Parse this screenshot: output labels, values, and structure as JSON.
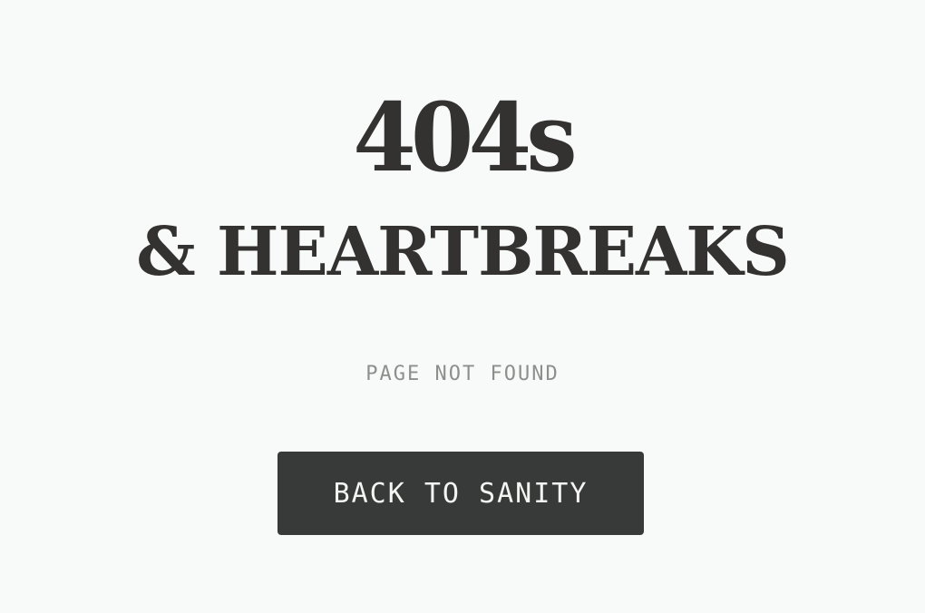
{
  "headline": {
    "line1": "404s",
    "line2": "& HEARTBREAKS"
  },
  "subtitle": "PAGE NOT FOUND",
  "cta": {
    "label": "BACK TO SANITY"
  },
  "colors": {
    "background": "#f8f9f9",
    "headline_text": "#333231",
    "subtitle_text": "#8e8e8c",
    "button_background": "#383a39",
    "button_text": "#f4f4f2"
  }
}
